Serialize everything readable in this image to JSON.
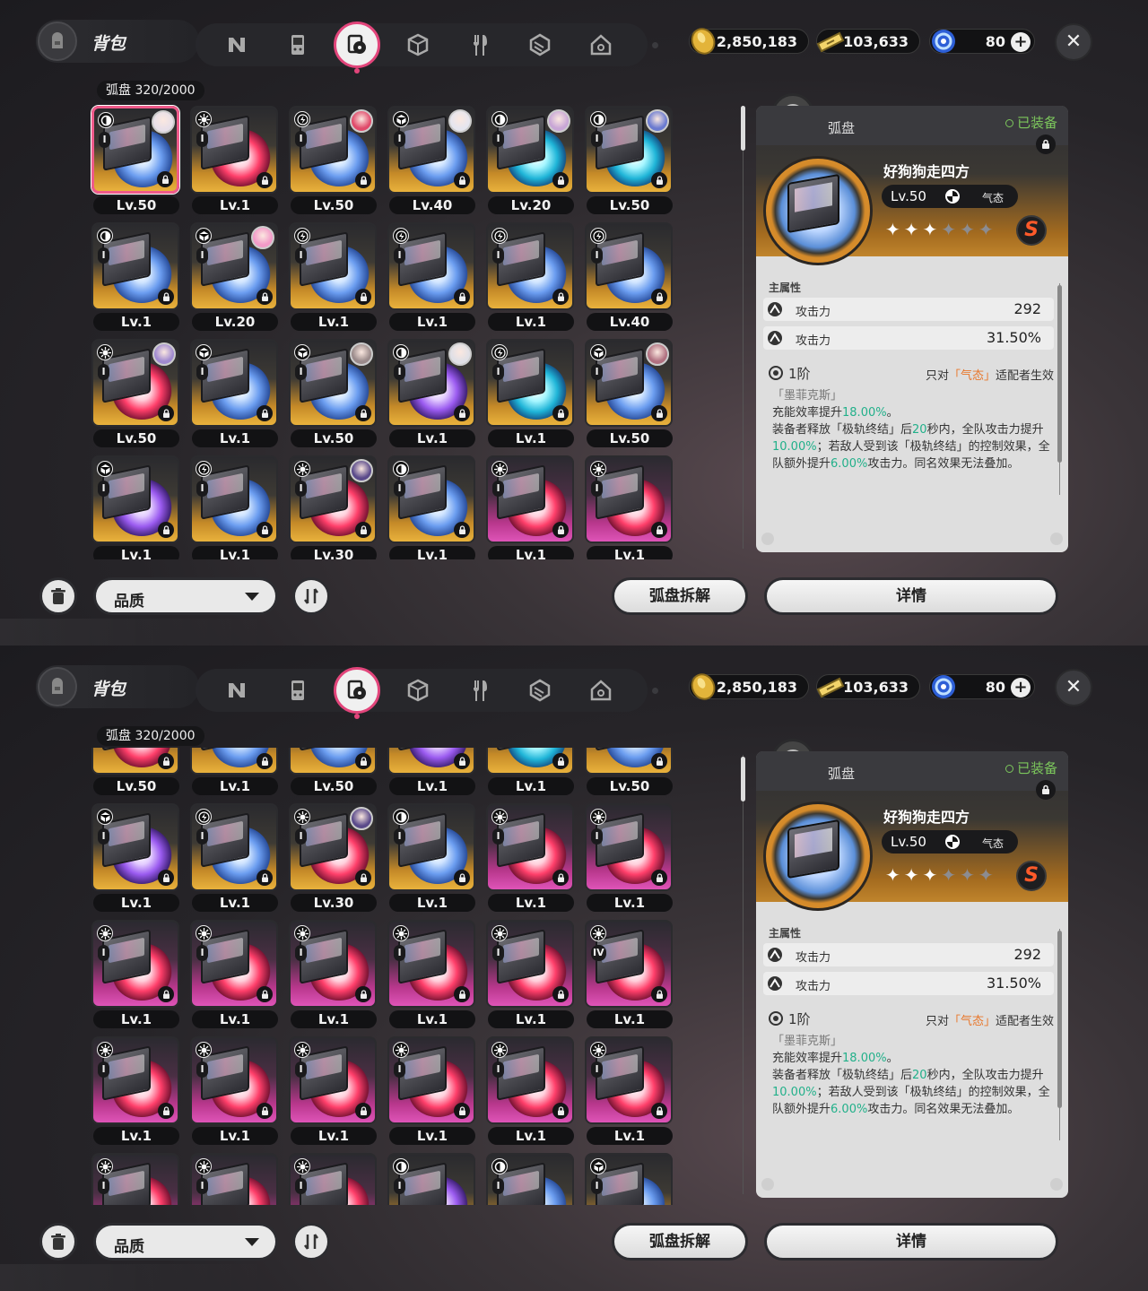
{
  "screens": [
    {
      "bag_title": "背包",
      "gold": "2,850,183",
      "ticket": "103,633",
      "gem": "80",
      "grid_title": "弧盘 320/2000",
      "cards": [
        {
          "lv": "Lv.50",
          "c": "gold",
          "d": "b",
          "rank": "I",
          "av": "#e8dfe8",
          "attr": "swirl",
          "sel": true
        },
        {
          "lv": "Lv.1",
          "c": "gold",
          "d": "r",
          "rank": "I",
          "attr": "sun"
        },
        {
          "lv": "Lv.50",
          "c": "gold",
          "d": "b",
          "rank": "I",
          "av": "#e04a6a",
          "attr": "bolt"
        },
        {
          "lv": "Lv.40",
          "c": "gold",
          "d": "b",
          "rank": "I",
          "av": "#e6e6ef",
          "attr": "cube"
        },
        {
          "lv": "Lv.20",
          "c": "gold",
          "d": "c",
          "rank": "I",
          "av": "#c8a6d6",
          "attr": "swirl"
        },
        {
          "lv": "Lv.50",
          "c": "gold",
          "d": "c",
          "rank": "I",
          "av": "#6a7ad0",
          "attr": "swirl"
        },
        {
          "lv": "Lv.1",
          "c": "gold",
          "d": "b",
          "rank": "I",
          "attr": "swirl"
        },
        {
          "lv": "Lv.20",
          "c": "gold",
          "d": "b",
          "rank": "I",
          "av": "#f29ac8",
          "attr": "cube"
        },
        {
          "lv": "Lv.1",
          "c": "gold",
          "d": "b",
          "rank": "I",
          "attr": "bolt"
        },
        {
          "lv": "Lv.1",
          "c": "gold",
          "d": "b",
          "rank": "I",
          "attr": "bolt"
        },
        {
          "lv": "Lv.1",
          "c": "gold",
          "d": "b",
          "rank": "I",
          "attr": "bolt"
        },
        {
          "lv": "Lv.40",
          "c": "gold",
          "d": "b",
          "rank": "I",
          "attr": "bolt"
        },
        {
          "lv": "Lv.50",
          "c": "gold",
          "d": "r",
          "rank": "I",
          "av": "#a08ad0",
          "attr": "sun"
        },
        {
          "lv": "Lv.1",
          "c": "gold",
          "d": "b",
          "rank": "I",
          "attr": "cube"
        },
        {
          "lv": "Lv.50",
          "c": "gold",
          "d": "b",
          "rank": "I",
          "av": "#9a8a8a",
          "attr": "cube"
        },
        {
          "lv": "Lv.1",
          "c": "gold",
          "d": "p",
          "rank": "I",
          "av": "#e0e0e6",
          "attr": "swirl"
        },
        {
          "lv": "Lv.1",
          "c": "gold",
          "d": "c",
          "rank": "I",
          "attr": "bolt"
        },
        {
          "lv": "Lv.50",
          "c": "gold",
          "d": "b",
          "rank": "I",
          "av": "#b07080",
          "attr": "cube"
        },
        {
          "lv": "Lv.1",
          "c": "gold",
          "d": "p",
          "rank": "I",
          "attr": "cube"
        },
        {
          "lv": "Lv.1",
          "c": "gold",
          "d": "b",
          "rank": "I",
          "attr": "bolt"
        },
        {
          "lv": "Lv.30",
          "c": "gold",
          "d": "r",
          "rank": "I",
          "av": "#5a4a8a",
          "attr": "sun"
        },
        {
          "lv": "Lv.1",
          "c": "gold",
          "d": "b",
          "rank": "I",
          "attr": "swirl"
        },
        {
          "lv": "Lv.1",
          "c": "pink",
          "d": "r",
          "rank": "I",
          "attr": "sun"
        },
        {
          "lv": "Lv.1",
          "c": "pink",
          "d": "r",
          "rank": "I",
          "attr": "sun"
        }
      ]
    },
    {
      "bag_title": "背包",
      "gold": "2,850,183",
      "ticket": "103,633",
      "gem": "80",
      "grid_title": "弧盘 320/2000",
      "cards": [
        {
          "lv": "Lv.50",
          "c": "gold",
          "d": "r",
          "rank": "I",
          "attr": "sun"
        },
        {
          "lv": "Lv.1",
          "c": "gold",
          "d": "b",
          "rank": "I",
          "attr": "cube"
        },
        {
          "lv": "Lv.50",
          "c": "gold",
          "d": "b",
          "rank": "I",
          "attr": "cube"
        },
        {
          "lv": "Lv.1",
          "c": "gold",
          "d": "p",
          "rank": "I",
          "attr": "swirl"
        },
        {
          "lv": "Lv.1",
          "c": "gold",
          "d": "c",
          "rank": "I",
          "attr": "bolt"
        },
        {
          "lv": "Lv.50",
          "c": "gold",
          "d": "b",
          "rank": "I",
          "attr": "cube"
        },
        {
          "lv": "Lv.1",
          "c": "gold",
          "d": "p",
          "rank": "I",
          "attr": "cube"
        },
        {
          "lv": "Lv.1",
          "c": "gold",
          "d": "b",
          "rank": "I",
          "attr": "bolt"
        },
        {
          "lv": "Lv.30",
          "c": "gold",
          "d": "r",
          "rank": "I",
          "av": "#5a4a8a",
          "attr": "sun"
        },
        {
          "lv": "Lv.1",
          "c": "gold",
          "d": "b",
          "rank": "I",
          "attr": "swirl"
        },
        {
          "lv": "Lv.1",
          "c": "pink",
          "d": "r",
          "rank": "I",
          "attr": "sun"
        },
        {
          "lv": "Lv.1",
          "c": "pink",
          "d": "r",
          "rank": "I",
          "attr": "sun"
        },
        {
          "lv": "Lv.1",
          "c": "pink",
          "d": "r",
          "rank": "I",
          "attr": "sun"
        },
        {
          "lv": "Lv.1",
          "c": "pink",
          "d": "r",
          "rank": "I",
          "attr": "sun"
        },
        {
          "lv": "Lv.1",
          "c": "pink",
          "d": "r",
          "rank": "I",
          "attr": "sun"
        },
        {
          "lv": "Lv.1",
          "c": "pink",
          "d": "r",
          "rank": "I",
          "attr": "sun"
        },
        {
          "lv": "Lv.1",
          "c": "pink",
          "d": "r",
          "rank": "I",
          "attr": "sun"
        },
        {
          "lv": "Lv.1",
          "c": "pink",
          "d": "r",
          "rank": "IV",
          "attr": "sun"
        },
        {
          "lv": "Lv.1",
          "c": "pink",
          "d": "r",
          "rank": "I",
          "attr": "sun"
        },
        {
          "lv": "Lv.1",
          "c": "pink",
          "d": "r",
          "rank": "I",
          "attr": "sun"
        },
        {
          "lv": "Lv.1",
          "c": "pink",
          "d": "r",
          "rank": "I",
          "attr": "sun"
        },
        {
          "lv": "Lv.1",
          "c": "pink",
          "d": "r",
          "rank": "I",
          "attr": "sun"
        },
        {
          "lv": "Lv.1",
          "c": "pink",
          "d": "r",
          "rank": "I",
          "attr": "sun"
        },
        {
          "lv": "Lv.1",
          "c": "pink",
          "d": "r",
          "rank": "I",
          "attr": "sun"
        },
        {
          "lv": "",
          "c": "pink",
          "d": "r",
          "rank": "I",
          "attr": "sun"
        },
        {
          "lv": "",
          "c": "pink",
          "d": "r",
          "rank": "I",
          "attr": "sun"
        },
        {
          "lv": "",
          "c": "pink",
          "d": "r",
          "rank": "I",
          "attr": "sun"
        },
        {
          "lv": "",
          "c": "gold",
          "d": "p",
          "rank": "I",
          "attr": "swirl"
        },
        {
          "lv": "",
          "c": "gold",
          "d": "b",
          "rank": "I",
          "attr": "swirl"
        },
        {
          "lv": "",
          "c": "gold",
          "d": "b",
          "rank": "I",
          "attr": "cube"
        }
      ]
    }
  ],
  "filter": {
    "quality_label": "品质"
  },
  "buttons": {
    "dismantle": "弧盘拆解",
    "details": "详情"
  },
  "detail": {
    "category": "弧盘",
    "equipped": "已装备",
    "name": "好狗狗走四方",
    "level": "Lv.50",
    "attribute": "气态",
    "stars_filled": 3,
    "stars_total": 6,
    "rarity_badge": "S",
    "main_attr_title": "主属性",
    "stats": [
      {
        "label": "攻击力",
        "value": "292"
      },
      {
        "label": "攻击力",
        "value": "31.50%"
      }
    ],
    "tier": "1阶",
    "condition_prefix": "只对",
    "condition_attr": "「气态」",
    "condition_suffix": "适配者生效",
    "effect_head": "「墨菲克斯」",
    "effect_l1a": "充能效率提升",
    "effect_l1v": "18.00%",
    "effect_l1b": "。",
    "effect_l2a": "装备者释放「极轨终结」后",
    "effect_l2v": "20",
    "effect_l2b": "秒内，全队攻击力提升",
    "effect_l2v2": "10.00%",
    "effect_l2c": "；若敌人受到该「极轨终结」的控制效果，全队额外提升",
    "effect_l2v3": "6.00%",
    "effect_l2d": "攻击力。同名效果无法叠加。"
  },
  "colors": {
    "accent_pink": "#e2457b",
    "equipped_green": "#7cc75c",
    "highlight_green": "#22b08a",
    "attr_orange": "#e8762a"
  }
}
